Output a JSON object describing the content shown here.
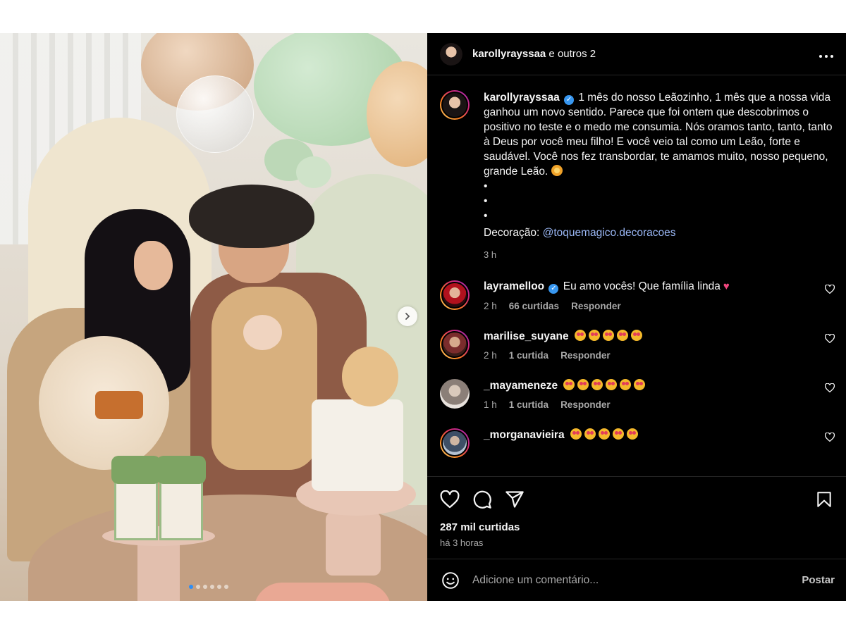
{
  "header": {
    "username": "karollyrayssaa",
    "suffix": " e outros 2",
    "more_label": "•••"
  },
  "caption": {
    "username": "karollyrayssaa",
    "verified": true,
    "text": "1 mês do nosso Leãozinho, 1 mês que a nossa vida ganhou um novo sentido. Parece que foi ontem que descobrimos o positivo no teste e o medo me consumia. Nós oramos tanto, tanto, tanto à Deus por você meu filho! E você veio tal como um Leão, forte e saudável. Você nos fez transbordar, te amamos muito, nosso pequeno, grande Leão.",
    "emoji": "lion-face-emoji",
    "dots": [
      "•",
      "•",
      "•"
    ],
    "decor_label": "Decoração: ",
    "decor_mention": "@toquemagico.decoracoes",
    "time": "3 h"
  },
  "comments": [
    {
      "username": "layramelloo",
      "verified": true,
      "text": "Eu amo vocês! Que família linda",
      "emoji": "pink-heart",
      "time": "2 h",
      "likes": "66 curtidas",
      "reply": "Responder"
    },
    {
      "username": "marilise_suyane",
      "verified": false,
      "text": "",
      "emoji_count": 5,
      "time": "2 h",
      "likes": "1 curtida",
      "reply": "Responder"
    },
    {
      "username": "_mayameneze",
      "verified": false,
      "text": "",
      "emoji_count": 6,
      "time": "1 h",
      "likes": "1 curtida",
      "reply": "Responder"
    },
    {
      "username": "_morganavieira",
      "verified": false,
      "text": "",
      "emoji_count": 5,
      "time": "",
      "likes": "",
      "reply": ""
    }
  ],
  "actions": {
    "likes": "287 mil curtidas",
    "posted": "há 3 horas"
  },
  "comment_box": {
    "placeholder": "Adicione um comentário...",
    "post_label": "Postar"
  },
  "carousel": {
    "count": 6,
    "active": 0
  },
  "colors": {
    "panel_bg": "#000000",
    "text": "#f5f5f5",
    "muted": "#a8a8a8",
    "link": "#9bb8f6",
    "verified": "#3897f0"
  }
}
